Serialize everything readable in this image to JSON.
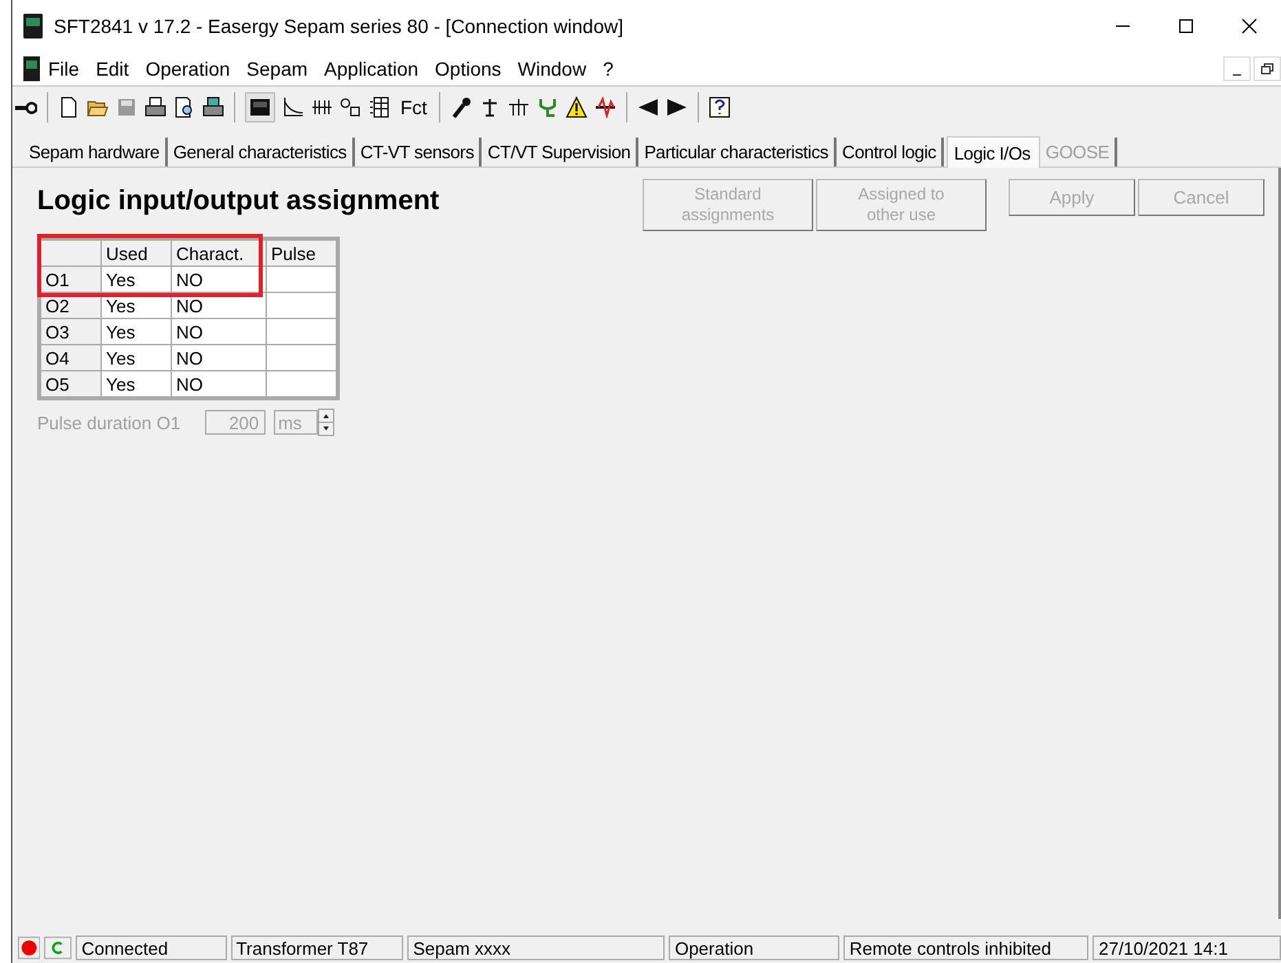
{
  "window": {
    "title": "SFT2841  v 17.2 - Easergy Sepam series 80 - [Connection window]"
  },
  "menu": [
    "File",
    "Edit",
    "Operation",
    "Sepam",
    "Application",
    "Options",
    "Window",
    "?"
  ],
  "toolbar": {
    "fct_label": "Fct"
  },
  "tabs": [
    {
      "label": "Sepam hardware",
      "selected": false,
      "disabled": false
    },
    {
      "label": "General characteristics",
      "selected": false,
      "disabled": false
    },
    {
      "label": "CT-VT sensors",
      "selected": false,
      "disabled": false
    },
    {
      "label": "CT/VT Supervision",
      "selected": false,
      "disabled": false
    },
    {
      "label": "Particular characteristics",
      "selected": false,
      "disabled": false
    },
    {
      "label": "Control logic",
      "selected": false,
      "disabled": false
    },
    {
      "label": "Logic I/Os",
      "selected": true,
      "disabled": false
    },
    {
      "label": "GOOSE",
      "selected": false,
      "disabled": true
    }
  ],
  "panel": {
    "heading": "Logic input/output assignment",
    "buttons": [
      {
        "label": "Standard assignments",
        "disabled": true
      },
      {
        "label": "Assigned to other use",
        "disabled": true
      },
      {
        "label": "Apply",
        "disabled": true
      },
      {
        "label": "Cancel",
        "disabled": true
      }
    ]
  },
  "table": {
    "columns": [
      "Used",
      "Charact.",
      "Pulse"
    ],
    "rows": [
      {
        "name": "O1",
        "used": "Yes",
        "charact": "NO",
        "highlighted": true
      },
      {
        "name": "O2",
        "used": "Yes",
        "charact": "NO",
        "highlighted": false
      },
      {
        "name": "O3",
        "used": "Yes",
        "charact": "NO",
        "highlighted": false
      },
      {
        "name": "O4",
        "used": "Yes",
        "charact": "NO",
        "highlighted": false
      },
      {
        "name": "O5",
        "used": "Yes",
        "charact": "NO",
        "highlighted": false
      }
    ]
  },
  "pulse_duration": {
    "label": "Pulse duration O1",
    "value": "200",
    "unit": "ms",
    "disabled": true
  },
  "status_bar": {
    "cells": [
      "Connected",
      "Transformer T87",
      "Sepam xxxx",
      "Operation",
      "Remote controls inhibited",
      "27/10/2021 14:1"
    ]
  }
}
